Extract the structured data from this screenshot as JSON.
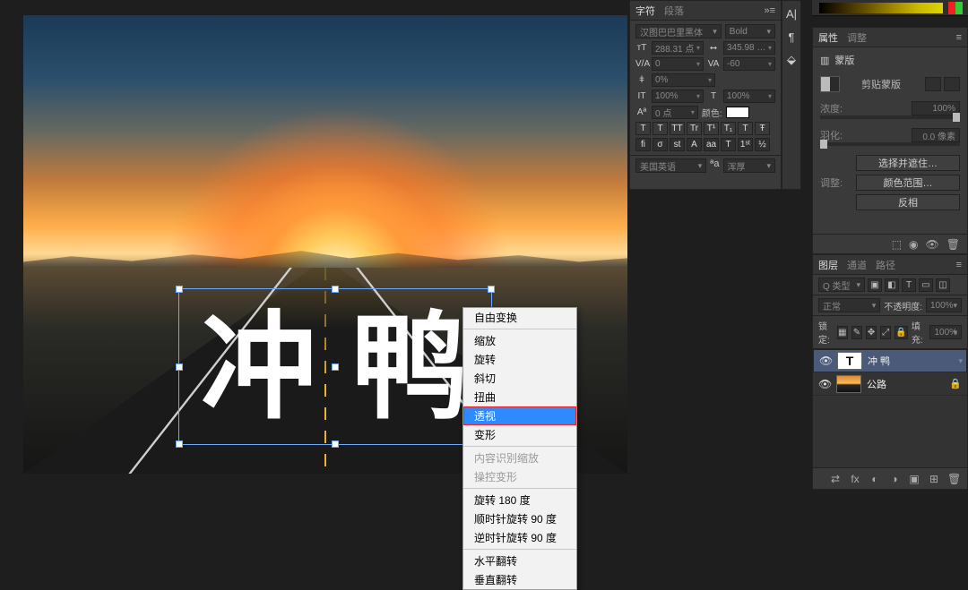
{
  "canvas": {
    "text_char1": "冲",
    "text_char2": "鸭"
  },
  "context_menu": {
    "free_transform": "自由变换",
    "scale": "缩放",
    "rotate": "旋转",
    "skew": "斜切",
    "distort": "扭曲",
    "perspective": "透视",
    "warp": "变形",
    "content_aware_scale": "内容识别缩放",
    "puppet_warp": "操控变形",
    "rotate180": "旋转 180 度",
    "rotate_cw90": "顺时针旋转 90 度",
    "rotate_ccw90": "逆时针旋转 90 度",
    "flip_h": "水平翻转",
    "flip_v": "垂直翻转"
  },
  "char_panel": {
    "tab1": "字符",
    "tab2": "段落",
    "font": "汉图巴巴里黑体",
    "weight": "Bold",
    "size": "288.31 点",
    "leading": "345.98 …",
    "va": "0",
    "tracking": "-60",
    "scale_h": "100%",
    "scale_v": "100%",
    "kern": "0%",
    "baseline": "0 点",
    "color_label": "颜色:",
    "btn_T1": "T",
    "btn_T2": "T",
    "btn_T3": "TT",
    "btn_T4": "Tr",
    "btn_T5": "T¹",
    "btn_T6": "T₁",
    "btn_T7": "T",
    "btn_T8": "Ŧ",
    "btn_fi": "fi",
    "btn_o": "σ",
    "btn_st": "st",
    "btn_A": "A",
    "btn_ad": "aa",
    "btn_T9": "T",
    "btn_1st": "1ˢᵗ",
    "btn_half": "½",
    "lang": "美国英语",
    "aa": "浑厚"
  },
  "side_icons": {
    "a_icon": "A|",
    "para_icon": "¶",
    "cube_icon": "⬙"
  },
  "tabs_props": {
    "tab1": "属性",
    "tab2": "调整"
  },
  "props": {
    "hdr_icon": "▥",
    "hdr": "蒙版",
    "mask_label": "剪贴蒙版",
    "density_label": "浓度:",
    "density_val": "100%",
    "feather_label": "羽化:",
    "feather_val": "0.0 像素",
    "refine_label": "调整:",
    "btn_select_and_mask": "选择并遮住…",
    "btn_color_range": "颜色范围…",
    "btn_invert": "反相"
  },
  "layers_panel": {
    "tab1": "图层",
    "tab2": "通道",
    "tab3": "路径",
    "kind": "Q 类型",
    "f_img": "▣",
    "f_adj": "◧",
    "f_T": "T",
    "f_shape": "▭",
    "f_smart": "◫",
    "mode": "正常",
    "opacity_label": "不透明度:",
    "opacity": "100%",
    "lock_label": "锁定:",
    "l1": "▦",
    "l2": "✎",
    "l3": "✥",
    "l4": "⤢",
    "l5": "🔒",
    "fill_label": "填充:",
    "fill": "100%",
    "layer1": "冲 鸭",
    "layer2": "公路",
    "bi_link": "⇄",
    "bi_fx": "fx",
    "bi_mask": "◐",
    "bi_adj": "◑",
    "bi_group": "▣",
    "bi_new": "⊞",
    "bi_trash": "🗑"
  }
}
